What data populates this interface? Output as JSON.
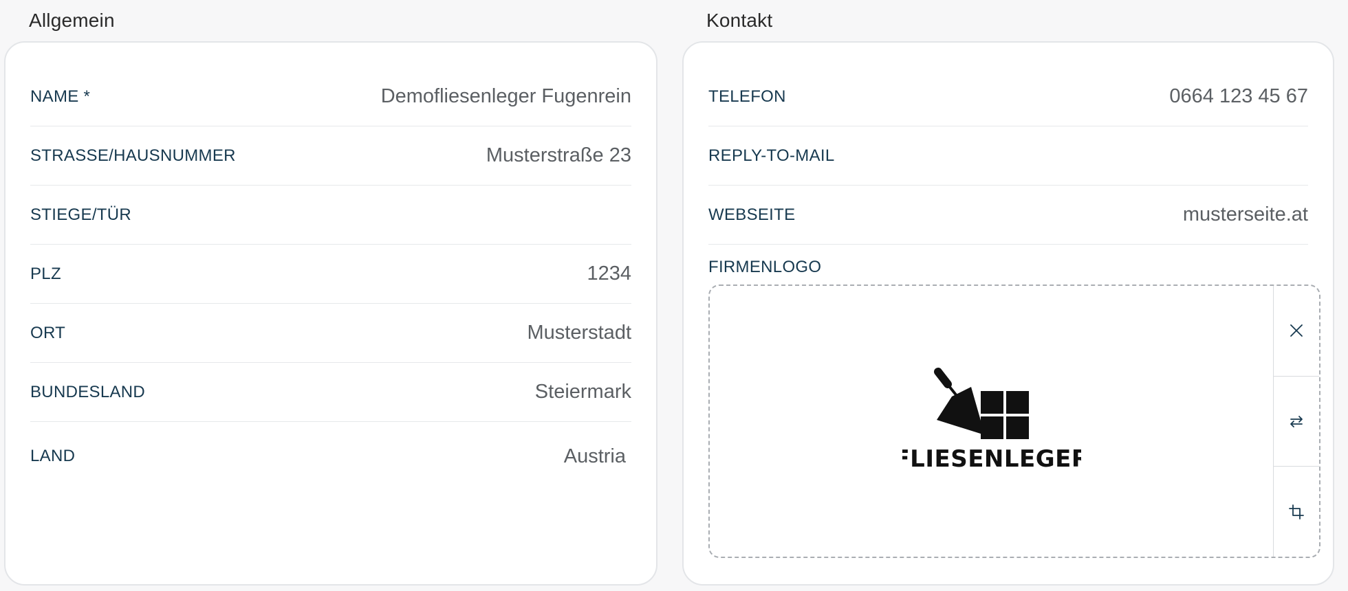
{
  "sections": {
    "general_title": "Allgemein",
    "contact_title": "Kontakt"
  },
  "general": {
    "rows": [
      {
        "label": "NAME *",
        "value": "Demofliesenleger Fugenrein"
      },
      {
        "label": "STRASSE/HAUSNUMMER",
        "value": "Musterstraße 23"
      },
      {
        "label": "STIEGE/TÜR",
        "value": ""
      },
      {
        "label": "PLZ",
        "value": "1234"
      },
      {
        "label": "ORT",
        "value": "Musterstadt"
      },
      {
        "label": "BUNDESLAND",
        "value": "Steiermark"
      },
      {
        "label": "LAND",
        "value": "Austria"
      }
    ]
  },
  "contact": {
    "rows": [
      {
        "label": "TELEFON",
        "value": "0664 123 45 67"
      },
      {
        "label": "REPLY-TO-MAIL",
        "value": ""
      },
      {
        "label": "WEBSEITE",
        "value": "musterseite.at"
      }
    ],
    "logo_label": "FIRMENLOGO",
    "logo_text": "FLIESENLEGER",
    "tools": [
      "close-icon",
      "swap-icon",
      "crop-icon"
    ]
  },
  "colors": {
    "label": "#17394f",
    "value": "#5b5f63",
    "border": "#e3e5e8"
  }
}
